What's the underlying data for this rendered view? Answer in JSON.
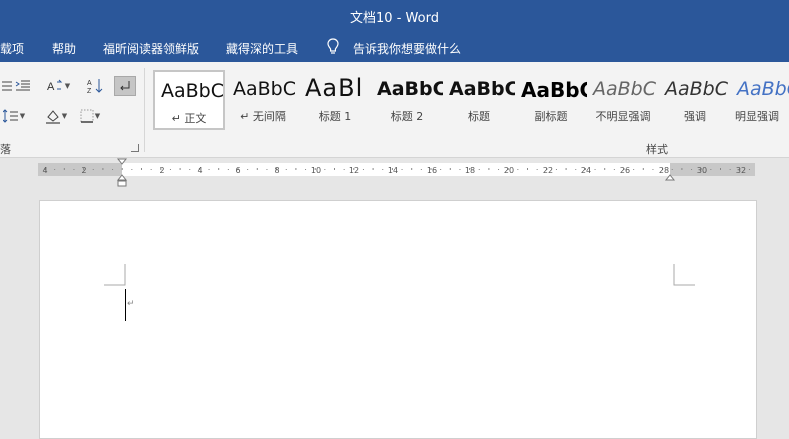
{
  "window": {
    "title": "文档10  -  Word"
  },
  "menu": {
    "items": [
      "载项",
      "帮助",
      "福昕阅读器领鲜版",
      "藏得深的工具"
    ],
    "tell_me": "告诉我你想要做什么"
  },
  "ribbon": {
    "paragraph_group_label": "落",
    "styles_group_label": "样式",
    "styles": [
      {
        "preview": "AaBbC",
        "label": "↵ 正文",
        "selected": true
      },
      {
        "preview": "AaBbC",
        "label": "↵ 无间隔"
      },
      {
        "preview": "AaBl",
        "label": "标题 1"
      },
      {
        "preview": "AaBbC",
        "label": "标题 2"
      },
      {
        "preview": "AaBbC",
        "label": "标题"
      },
      {
        "preview": "AaBbC",
        "label": "副标题"
      },
      {
        "preview": "AaBbC",
        "label": "不明显强调"
      },
      {
        "preview": "AaBbC",
        "label": "强调"
      },
      {
        "preview": "AaBbC",
        "label": "明显强调"
      }
    ]
  },
  "ruler": {
    "labels": [
      "4",
      "2",
      "2",
      "4",
      "6",
      "8",
      "10",
      "12",
      "14",
      "16",
      "18",
      "20",
      "22",
      "24",
      "26",
      "28",
      "30",
      "32"
    ]
  },
  "icons": {
    "bullets": "list-icon",
    "indent": "increase-indent-icon",
    "text_direction": "text-direction-icon",
    "sort": "sort-icon",
    "pilcrow": "show-formatting-icon",
    "line_spacing": "line-spacing-icon",
    "shading": "shading-icon",
    "borders": "borders-icon",
    "lightbulb": "lightbulb-icon"
  },
  "colors": {
    "title_bar": "#2b579a",
    "ribbon": "#f3f3f3",
    "canvas": "#e6e6e6"
  }
}
